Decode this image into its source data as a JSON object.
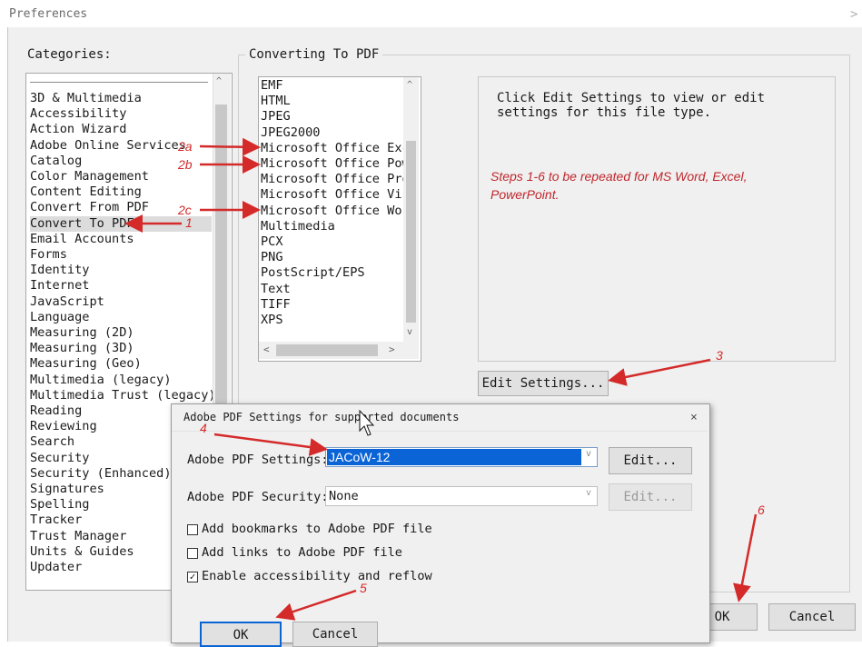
{
  "window": {
    "title": "Preferences",
    "close_glyph": ">"
  },
  "categories": {
    "label": "Categories:",
    "items": [
      "3D & Multimedia",
      "Accessibility",
      "Action Wizard",
      "Adobe Online Services",
      "Catalog",
      "Color Management",
      "Content Editing",
      "Convert From PDF",
      "Convert To PDF",
      "Email Accounts",
      "Forms",
      "Identity",
      "Internet",
      "JavaScript",
      "Language",
      "Measuring (2D)",
      "Measuring (3D)",
      "Measuring (Geo)",
      "Multimedia (legacy)",
      "Multimedia Trust (legacy)",
      "Reading",
      "Reviewing",
      "Search",
      "Security",
      "Security (Enhanced)",
      "Signatures",
      "Spelling",
      "Tracker",
      "Trust Manager",
      "Units & Guides",
      "Updater"
    ],
    "selected": "Convert To PDF"
  },
  "converting": {
    "label": "Converting To PDF",
    "file_types": [
      "EMF",
      "HTML",
      "JPEG",
      "JPEG2000",
      "Microsoft Office Excel",
      "Microsoft Office PowerPoint",
      "Microsoft Office Project",
      "Microsoft Office Visio",
      "Microsoft Office Word",
      "Multimedia",
      "PCX",
      "PNG",
      "PostScript/EPS",
      "Text",
      "TIFF",
      "XPS"
    ],
    "info_text": "Click Edit Settings to view or edit settings for this file type.",
    "edit_settings_label": "Edit Settings..."
  },
  "note": "Steps 1-6 to be repeated for MS Word, Excel, PowerPoint.",
  "main_buttons": {
    "ok": "OK",
    "cancel": "Cancel"
  },
  "dialog": {
    "title": "Adobe PDF Settings for supported documents",
    "close_glyph": "×",
    "settings_label": "Adobe PDF Settings:",
    "settings_value": "JACoW-12",
    "security_label": "Adobe PDF Security:",
    "security_value": "None",
    "edit_label": "Edit...",
    "edit_disabled_label": "Edit...",
    "checkboxes": [
      {
        "label": "Add bookmarks to Adobe PDF file",
        "checked": false
      },
      {
        "label": "Add links to Adobe PDF file",
        "checked": false
      },
      {
        "label": "Enable accessibility and reflow",
        "checked": true
      }
    ],
    "ok": "OK",
    "cancel": "Cancel"
  },
  "annotations": {
    "a1": "1",
    "a2a": "2a",
    "a2b": "2b",
    "a2c": "2c",
    "a3": "3",
    "a4": "4",
    "a5": "5",
    "a6": "6",
    "color": "#d42a2a"
  }
}
